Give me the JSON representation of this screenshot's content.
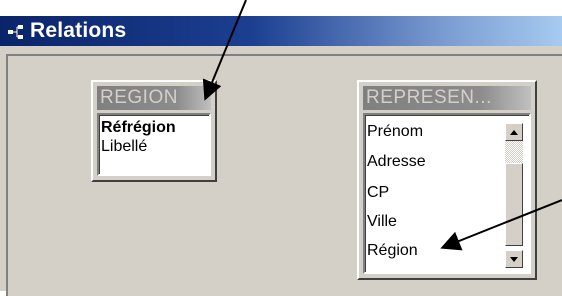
{
  "window": {
    "title": "Relations",
    "icon": "relations-icon"
  },
  "tables": [
    {
      "name": "REGION",
      "fields": [
        {
          "label": "Réfrégion",
          "primary_key": true
        },
        {
          "label": "Libellé",
          "primary_key": false
        }
      ]
    },
    {
      "name": "REPRESEN...",
      "fields": [
        {
          "label": "Prénom",
          "primary_key": false
        },
        {
          "label": "Adresse",
          "primary_key": false
        },
        {
          "label": "CP",
          "primary_key": false
        },
        {
          "label": "Ville",
          "primary_key": false
        },
        {
          "label": "Région",
          "primary_key": false
        }
      ],
      "scrollbar": {
        "up_icon": "scroll-up-arrow-icon",
        "down_icon": "scroll-down-arrow-icon"
      }
    }
  ],
  "annotations": [
    {
      "name": "arrow-to-region-title",
      "icon": "arrow-icon"
    },
    {
      "name": "arrow-to-region-field",
      "icon": "arrow-icon"
    }
  ],
  "colors": {
    "titlebar_start": "#0a246a",
    "titlebar_end": "#a6caf0",
    "dialog_face": "#d4d0c8",
    "annotation_arrow": "#000000"
  }
}
